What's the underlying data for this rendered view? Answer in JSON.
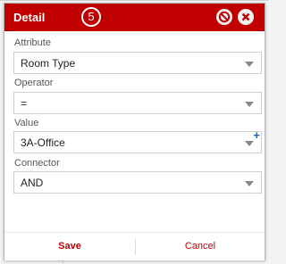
{
  "dialog": {
    "title": "Detail",
    "step": "5",
    "accent_color": "#c00000",
    "header_icons": [
      "clear-icon",
      "close-icon"
    ]
  },
  "fields": {
    "attribute": {
      "label": "Attribute",
      "value": "Room Type"
    },
    "operator": {
      "label": "Operator",
      "value": "="
    },
    "value": {
      "label": "Value",
      "value": "3A-Office",
      "add_icon": "plus-icon"
    },
    "connector": {
      "label": "Connector",
      "value": "AND"
    }
  },
  "footer": {
    "save_label": "Save",
    "cancel_label": "Cancel"
  }
}
